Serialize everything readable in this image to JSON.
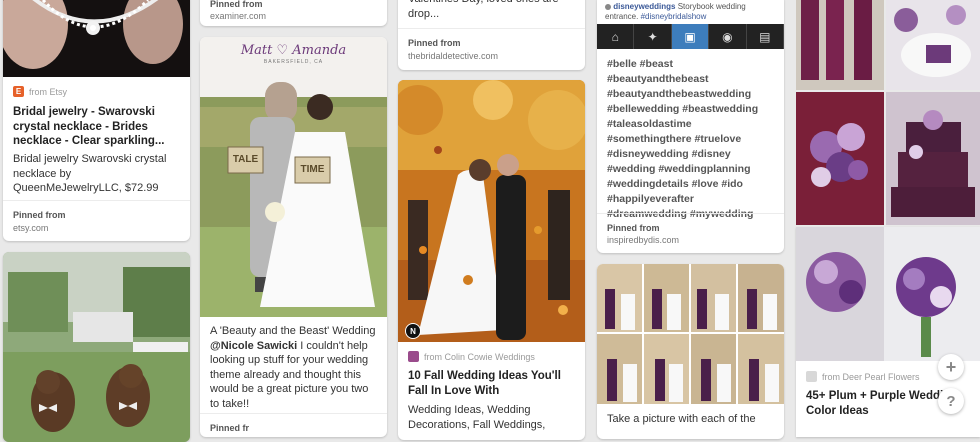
{
  "col1": {
    "card1": {
      "source": "from Etsy",
      "title": "Bridal jewelry - Swarovski crystal necklace - Brides necklace - Clear sparkling...",
      "desc": "Bridal jewelry Swarovski crystal necklace by QueenMeJewelryLLC, $72.99",
      "pinned_label": "Pinned from",
      "pinned_site": "etsy.com"
    }
  },
  "col2": {
    "top_card": {
      "pinned_label": "Pinned from",
      "pinned_site": "examiner.com"
    },
    "card2": {
      "photo_heading": "Matt ♡ Amanda",
      "photo_sub": "BAKERSFIELD, CA",
      "sign_left": "TALE",
      "sign_right": "TIME",
      "desc_pre": "A 'Beauty and the Beast' Wedding ",
      "desc_mention": "@Nicole Sawicki",
      "desc_post": " I couldn't help looking up stuff for your wedding theme already and thought this would be a great picture you two to take!!",
      "pinned_label": "Pinned fr"
    }
  },
  "col3": {
    "top_card": {
      "desc": "Valentines Day, loved ones are drop...",
      "pinned_label": "Pinned from",
      "pinned_site": "thebridaldetective.com"
    },
    "card2": {
      "source": "from Colin Cowie Weddings",
      "title": "10 Fall Wedding Ideas You'll Fall In Love With",
      "desc": "Wedding Ideas, Wedding Decorations, Fall Weddings,"
    }
  },
  "col4": {
    "top_card": {
      "ig_user": "disneyweddings",
      "ig_caption": "Storybook wedding entrance.",
      "ig_tag": "#disneybridalshow",
      "hashtags": "#belle #beast #beautyandthebeast #beautyandthebeastwedding #bellewedding #beastwedding #taleasoldastime #somethingthere #truelove #disneywedding #disney #wedding #weddingplanning #weddingdetails #love #ido #happilyeverafter #dreamwedding #mywedding",
      "pinned_label": "Pinned from",
      "pinned_site": "inspiredbydis.com"
    },
    "card2": {
      "desc": "Take a picture with each of the"
    }
  },
  "col5": {
    "card1": {
      "source": "from Deer Pearl Flowers",
      "title": "45+ Plum + Purple Wedding Color Ideas"
    }
  },
  "fab": {
    "add": "+",
    "help": "?"
  }
}
